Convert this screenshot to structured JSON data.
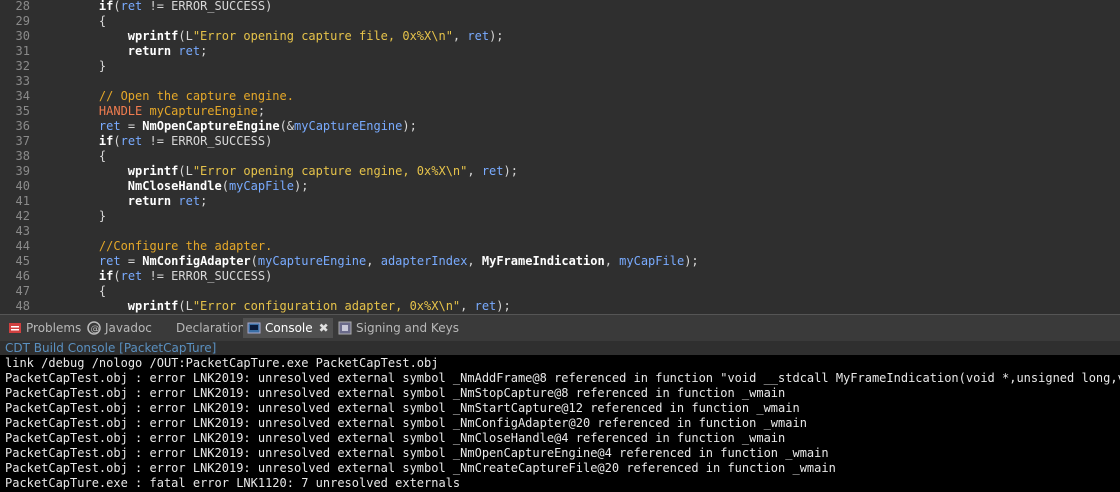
{
  "editor": {
    "lines": [
      {
        "n": "28",
        "parts": [
          {
            "c": "plain",
            "t": "    "
          },
          {
            "c": "kw",
            "t": "if"
          },
          {
            "c": "plain",
            "t": "("
          },
          {
            "c": "var",
            "t": "ret"
          },
          {
            "c": "plain",
            "t": " != ERROR_SUCCESS)"
          }
        ]
      },
      {
        "n": "29",
        "parts": [
          {
            "c": "plain",
            "t": "    {"
          }
        ]
      },
      {
        "n": "30",
        "parts": [
          {
            "c": "plain",
            "t": "        "
          },
          {
            "c": "fn",
            "t": "wprintf"
          },
          {
            "c": "plain",
            "t": "(L"
          },
          {
            "c": "str",
            "t": "\"Error opening capture file, 0x%X\\n\""
          },
          {
            "c": "plain",
            "t": ", "
          },
          {
            "c": "var",
            "t": "ret"
          },
          {
            "c": "plain",
            "t": ");"
          }
        ]
      },
      {
        "n": "31",
        "parts": [
          {
            "c": "plain",
            "t": "        "
          },
          {
            "c": "kw",
            "t": "return"
          },
          {
            "c": "plain",
            "t": " "
          },
          {
            "c": "var",
            "t": "ret"
          },
          {
            "c": "plain",
            "t": ";"
          }
        ]
      },
      {
        "n": "32",
        "parts": [
          {
            "c": "plain",
            "t": "    }"
          }
        ]
      },
      {
        "n": "33",
        "parts": []
      },
      {
        "n": "34",
        "parts": [
          {
            "c": "plain",
            "t": "    "
          },
          {
            "c": "cmt",
            "t": "// Open the capture engine."
          }
        ]
      },
      {
        "n": "35",
        "parts": [
          {
            "c": "plain",
            "t": "    "
          },
          {
            "c": "type",
            "t": "HANDLE"
          },
          {
            "c": "plain",
            "t": " "
          },
          {
            "c": "cmt",
            "t": "myCaptureEngine"
          },
          {
            "c": "plain",
            "t": ";"
          }
        ]
      },
      {
        "n": "36",
        "parts": [
          {
            "c": "plain",
            "t": "    "
          },
          {
            "c": "var",
            "t": "ret"
          },
          {
            "c": "plain",
            "t": " = "
          },
          {
            "c": "fn",
            "t": "NmOpenCaptureEngine"
          },
          {
            "c": "plain",
            "t": "(&"
          },
          {
            "c": "var",
            "t": "myCaptureEngine"
          },
          {
            "c": "plain",
            "t": ");"
          }
        ]
      },
      {
        "n": "37",
        "parts": [
          {
            "c": "plain",
            "t": "    "
          },
          {
            "c": "kw",
            "t": "if"
          },
          {
            "c": "plain",
            "t": "("
          },
          {
            "c": "var",
            "t": "ret"
          },
          {
            "c": "plain",
            "t": " != ERROR_SUCCESS)"
          }
        ]
      },
      {
        "n": "38",
        "parts": [
          {
            "c": "plain",
            "t": "    {"
          }
        ]
      },
      {
        "n": "39",
        "parts": [
          {
            "c": "plain",
            "t": "        "
          },
          {
            "c": "fn",
            "t": "wprintf"
          },
          {
            "c": "plain",
            "t": "(L"
          },
          {
            "c": "str",
            "t": "\"Error opening capture engine, 0x%X\\n\""
          },
          {
            "c": "plain",
            "t": ", "
          },
          {
            "c": "var",
            "t": "ret"
          },
          {
            "c": "plain",
            "t": ");"
          }
        ]
      },
      {
        "n": "40",
        "parts": [
          {
            "c": "plain",
            "t": "        "
          },
          {
            "c": "fn",
            "t": "NmCloseHandle"
          },
          {
            "c": "plain",
            "t": "("
          },
          {
            "c": "var",
            "t": "myCapFile"
          },
          {
            "c": "plain",
            "t": ");"
          }
        ]
      },
      {
        "n": "41",
        "parts": [
          {
            "c": "plain",
            "t": "        "
          },
          {
            "c": "kw",
            "t": "return"
          },
          {
            "c": "plain",
            "t": " "
          },
          {
            "c": "var",
            "t": "ret"
          },
          {
            "c": "plain",
            "t": ";"
          }
        ]
      },
      {
        "n": "42",
        "parts": [
          {
            "c": "plain",
            "t": "    }"
          }
        ]
      },
      {
        "n": "43",
        "parts": []
      },
      {
        "n": "44",
        "parts": [
          {
            "c": "plain",
            "t": "    "
          },
          {
            "c": "cmt",
            "t": "//Configure the adapter."
          }
        ]
      },
      {
        "n": "45",
        "parts": [
          {
            "c": "plain",
            "t": "    "
          },
          {
            "c": "var",
            "t": "ret"
          },
          {
            "c": "plain",
            "t": " = "
          },
          {
            "c": "fn",
            "t": "NmConfigAdapter"
          },
          {
            "c": "plain",
            "t": "("
          },
          {
            "c": "var",
            "t": "myCaptureEngine"
          },
          {
            "c": "plain",
            "t": ", "
          },
          {
            "c": "var",
            "t": "adapterIndex"
          },
          {
            "c": "plain",
            "t": ", "
          },
          {
            "c": "fn",
            "t": "MyFrameIndication"
          },
          {
            "c": "plain",
            "t": ", "
          },
          {
            "c": "var",
            "t": "myCapFile"
          },
          {
            "c": "plain",
            "t": ");"
          }
        ]
      },
      {
        "n": "46",
        "parts": [
          {
            "c": "plain",
            "t": "    "
          },
          {
            "c": "kw",
            "t": "if"
          },
          {
            "c": "plain",
            "t": "("
          },
          {
            "c": "var",
            "t": "ret"
          },
          {
            "c": "plain",
            "t": " != ERROR_SUCCESS)"
          }
        ]
      },
      {
        "n": "47",
        "parts": [
          {
            "c": "plain",
            "t": "    {"
          }
        ]
      },
      {
        "n": "48",
        "parts": [
          {
            "c": "plain",
            "t": "        "
          },
          {
            "c": "fn",
            "t": "wprintf"
          },
          {
            "c": "plain",
            "t": "(L"
          },
          {
            "c": "str",
            "t": "\"Error configuration adapter, 0x%X\\n\""
          },
          {
            "c": "plain",
            "t": ", "
          },
          {
            "c": "var",
            "t": "ret"
          },
          {
            "c": "plain",
            "t": ");"
          }
        ]
      }
    ]
  },
  "tabs": [
    {
      "label": "Problems",
      "icon": "problems-icon"
    },
    {
      "label": "Javadoc",
      "icon": "javadoc-icon"
    },
    {
      "label": "Declaration",
      "icon": "declaration-icon"
    },
    {
      "label": "Console",
      "icon": "console-icon",
      "active": true,
      "close": "✖"
    },
    {
      "label": "Signing and Keys",
      "icon": "signing-icon"
    }
  ],
  "console": {
    "title": "CDT Build Console [PacketCapTure]",
    "lines": [
      "link /debug /nologo /OUT:PacketCapTure.exe PacketCapTest.obj",
      "PacketCapTest.obj : error LNK2019: unresolved external symbol _NmAddFrame@8 referenced in function \"void __stdcall MyFrameIndication(void *,unsigned long,void",
      "PacketCapTest.obj : error LNK2019: unresolved external symbol _NmStopCapture@8 referenced in function _wmain",
      "PacketCapTest.obj : error LNK2019: unresolved external symbol _NmStartCapture@12 referenced in function _wmain",
      "PacketCapTest.obj : error LNK2019: unresolved external symbol _NmConfigAdapter@20 referenced in function _wmain",
      "PacketCapTest.obj : error LNK2019: unresolved external symbol _NmCloseHandle@4 referenced in function _wmain",
      "PacketCapTest.obj : error LNK2019: unresolved external symbol _NmOpenCaptureEngine@4 referenced in function _wmain",
      "PacketCapTest.obj : error LNK2019: unresolved external symbol _NmCreateCaptureFile@20 referenced in function _wmain",
      "PacketCapTure.exe : fatal error LNK1120: 7 unresolved externals"
    ]
  }
}
